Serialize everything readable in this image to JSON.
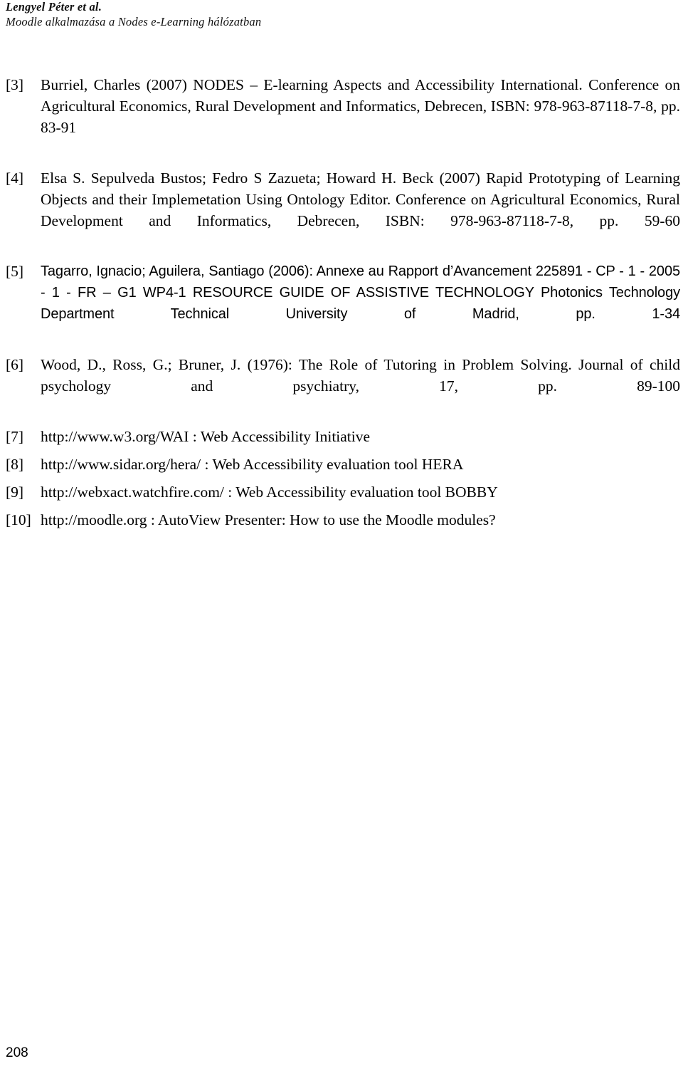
{
  "header": {
    "author_line": "Lengyel Péter et al.",
    "title_line": "Moodle alkalmazása a Nodes e-Learning hálózatban"
  },
  "references": [
    {
      "marker": "[3]",
      "text": "Burriel, Charles (2007) NODES – E-learning Aspects and Accessibility International. Conference on Agricultural Economics, Rural Development and Informatics, Debrecen, ISBN: 978-963-87118-7-8, pp. 83-91",
      "font": "serif"
    },
    {
      "marker": "[4]",
      "text": "Elsa S. Sepulveda Bustos; Fedro S Zazueta; Howard H. Beck (2007) Rapid Prototyping of Learning Objects and their Implemetation Using Ontology Editor. Conference on Agricultural Economics, Rural Development and Informatics, Debrecen, ISBN: 978-963-87118-7-8, pp. 59-60",
      "font": "serif"
    },
    {
      "marker": "[5]",
      "text": "Tagarro, Ignacio; Aguilera, Santiago (2006): Annexe au Rapport d’Avancement 225891 - CP - 1 - 2005 - 1 - FR – G1 WP4-1 RESOURCE GUIDE OF ASSISTIVE TECHNOLOGY Photonics Technology Department Technical University of Madrid, pp. 1-34",
      "font": "sans"
    },
    {
      "marker": "[6]",
      "text": "Wood, D., Ross, G.; Bruner, J. (1976): The Role of Tutoring in Problem Solving. Journal of child psychology and psychiatry, 17, pp. 89-100",
      "font": "serif"
    },
    {
      "marker": "[7]",
      "text": "http://www.w3.org/WAI : Web Accessibility Initiative",
      "font": "serif"
    },
    {
      "marker": "[8]",
      "text": "http://www.sidar.org/hera/ : Web Accessibility evaluation tool HERA",
      "font": "serif"
    },
    {
      "marker": "[9]",
      "text": "http://webxact.watchfire.com/ : Web Accessibility evaluation tool BOBBY",
      "font": "serif"
    },
    {
      "marker": "[10]",
      "text": "http://moodle.org : AutoView Presenter: How to use the Moodle modules?",
      "font": "serif"
    }
  ],
  "footer": {
    "page_number": "208"
  }
}
